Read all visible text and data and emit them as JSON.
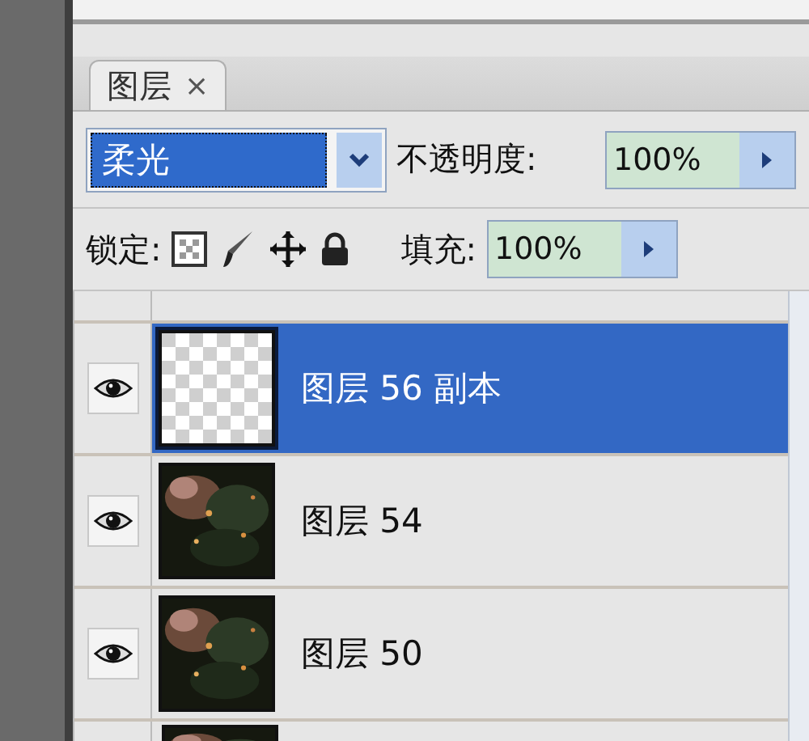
{
  "panel_tab": {
    "label": "图层",
    "close": "×"
  },
  "blend_mode": {
    "value": "柔光"
  },
  "opacity": {
    "label": "不透明度:",
    "value": "100%"
  },
  "lock": {
    "label": "锁定:"
  },
  "fill": {
    "label": "填充:",
    "value": "100%"
  },
  "layers": [
    {
      "name": "图层 56 副本",
      "visible": true,
      "selected": true,
      "kind": "transparent"
    },
    {
      "name": "图层 54",
      "visible": true,
      "selected": false,
      "kind": "picture"
    },
    {
      "name": "图层 50",
      "visible": true,
      "selected": false,
      "kind": "picture"
    }
  ]
}
